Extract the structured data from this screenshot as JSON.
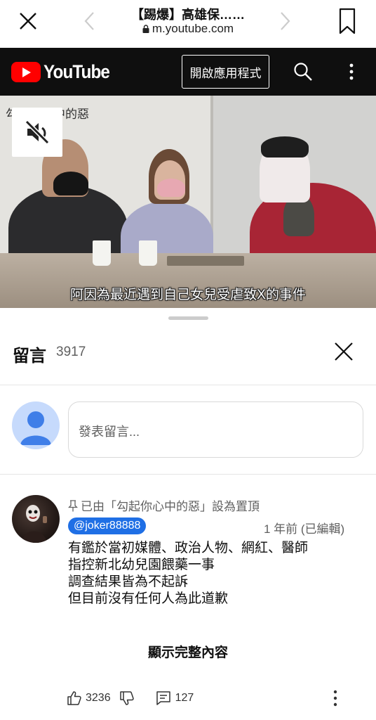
{
  "browser": {
    "title": "【踢爆】高雄保……",
    "url": "m.youtube.com"
  },
  "youtube": {
    "logo_text": "YouTube",
    "open_app_label": "開啟應用程式"
  },
  "video": {
    "caption": "阿因為最近遇到自己女兒受虐致X的事件",
    "watermark": "勾起你心中的惡"
  },
  "comments": {
    "title": "留言",
    "count": "3917",
    "input_placeholder": "發表留言...",
    "items": [
      {
        "pinned_text": "已由「勾起你心中的惡」設為置頂",
        "author": "@joker88888",
        "timestamp": "1 年前 (已編輯)",
        "lines": [
          "有鑑於當初媒體、政治人物、網紅、醫師",
          "指控新北幼兒園餵藥一事",
          "調查結果皆為不起訴",
          "但目前沒有任何人為此道歉"
        ],
        "show_more_label": "顯示完整內容",
        "like_count": "3236",
        "reply_count": "127"
      }
    ]
  },
  "colors": {
    "youtube_red": "#ff0000",
    "header_bg": "#0f0f0f",
    "author_badge": "#1f6fe5"
  }
}
